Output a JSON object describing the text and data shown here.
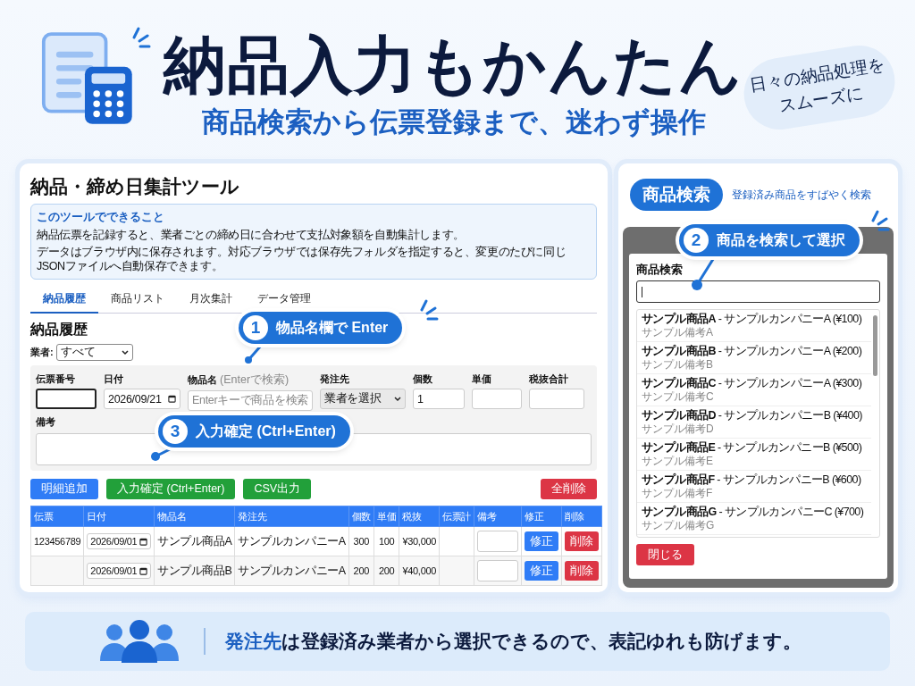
{
  "header": {
    "title": "納品入力もかんたん",
    "subtitle": "商品検索から伝票登録まで、迷わず操作",
    "note_lines": [
      "日々の納品処理を",
      "スムーズに"
    ]
  },
  "tool": {
    "title": "納品・締め日集計ツール",
    "info": {
      "heading": "このツールでできること",
      "lines": [
        "納品伝票を記録すると、業者ごとの締め日に合わせて支払対象額を自動集計します。",
        "データはブラウザ内に保存されます。対応ブラウザでは保存先フォルダを指定すると、変更のたびに同じJSONファイルへ自動保存できます。"
      ]
    },
    "tabs": [
      {
        "label": "納品履歴",
        "selected": true
      },
      {
        "label": "商品リスト",
        "selected": false
      },
      {
        "label": "月次集計",
        "selected": false
      },
      {
        "label": "データ管理",
        "selected": false
      }
    ],
    "section_title": "納品履歴",
    "filter": {
      "label": "業者:",
      "value": "すべて"
    },
    "fields": [
      {
        "label": "伝票番号",
        "kind": "text",
        "focused": true
      },
      {
        "label": "日付",
        "kind": "date",
        "value": "2026/09/21",
        "focused": false
      },
      {
        "label": "物品名",
        "hint": "(Enterで検索)",
        "kind": "text",
        "placeholder": "Enterキーで商品を検索",
        "focused": false
      },
      {
        "label": "発注先",
        "kind": "select",
        "value": "業者を選択",
        "focused": false
      },
      {
        "label": "個数",
        "kind": "text",
        "value": "1",
        "focused": false
      },
      {
        "label": "単価",
        "kind": "text",
        "focused": false
      },
      {
        "label": "税抜合計",
        "kind": "text",
        "focused": false
      }
    ],
    "note_label": "備考",
    "buttons": [
      {
        "label": "明細追加",
        "kind": "primary"
      },
      {
        "label": "入力確定 (Ctrl+Enter)",
        "kind": "success"
      },
      {
        "label": "CSV出力",
        "kind": "success"
      },
      {
        "label": "全削除",
        "kind": "danger"
      }
    ],
    "table": {
      "columns": [
        "伝票",
        "日付",
        "物品名",
        "発注先",
        "個数",
        "単価",
        "税抜",
        "伝票計",
        "備考",
        "修正",
        "削除"
      ],
      "rows": [
        {
          "voucher": "123456789",
          "date": "2026/09/01",
          "item": "サンプル商品A",
          "supplier": "サンプルカンパニーA",
          "qty": "300",
          "price": "100",
          "subtotal": "¥30,000",
          "edit": "修正",
          "delete": "削除"
        },
        {
          "date": "2026/09/01",
          "item": "サンプル商品B",
          "supplier": "サンプルカンパニーA",
          "qty": "200",
          "price": "200",
          "subtotal": "¥40,000",
          "edit": "修正",
          "delete": "削除"
        }
      ]
    },
    "callouts": [
      {
        "number": "1",
        "text": "物品名欄で Enter"
      },
      {
        "number": "3",
        "text": "入力確定 (Ctrl+Enter)"
      }
    ]
  },
  "search_panel": {
    "badge": "商品検索",
    "caption": "登録済み商品をすばやく検索",
    "callout": {
      "number": "2",
      "text": "商品を検索して選択"
    },
    "modal": {
      "label": "商品検索",
      "results": [
        {
          "title": "**サンプル商品A** - サンプルカンパニーA (¥100)",
          "note": "サンプル備考A"
        },
        {
          "title": "**サンプル商品B** - サンプルカンパニーA (¥200)",
          "note": "サンプル備考B"
        },
        {
          "title": "**サンプル商品C** - サンプルカンパニーA (¥300)",
          "note": "サンプル備考C"
        },
        {
          "title": "**サンプル商品D** - サンプルカンパニーB (¥400)",
          "note": "サンプル備考D"
        },
        {
          "title": "**サンプル商品E** - サンプルカンパニーB (¥500)",
          "note": "サンプル備考E"
        },
        {
          "title": "**サンプル商品F** - サンプルカンパニーB (¥600)",
          "note": "サンプル備考F"
        },
        {
          "title": "**サンプル商品G** - サンプルカンパニーC (¥700)",
          "note": "サンプル備考G"
        }
      ],
      "close": "閉じる"
    }
  },
  "footer": {
    "text": "**発注先**は登録済み業者から選択できるので、表記ゆれも防げます。"
  }
}
